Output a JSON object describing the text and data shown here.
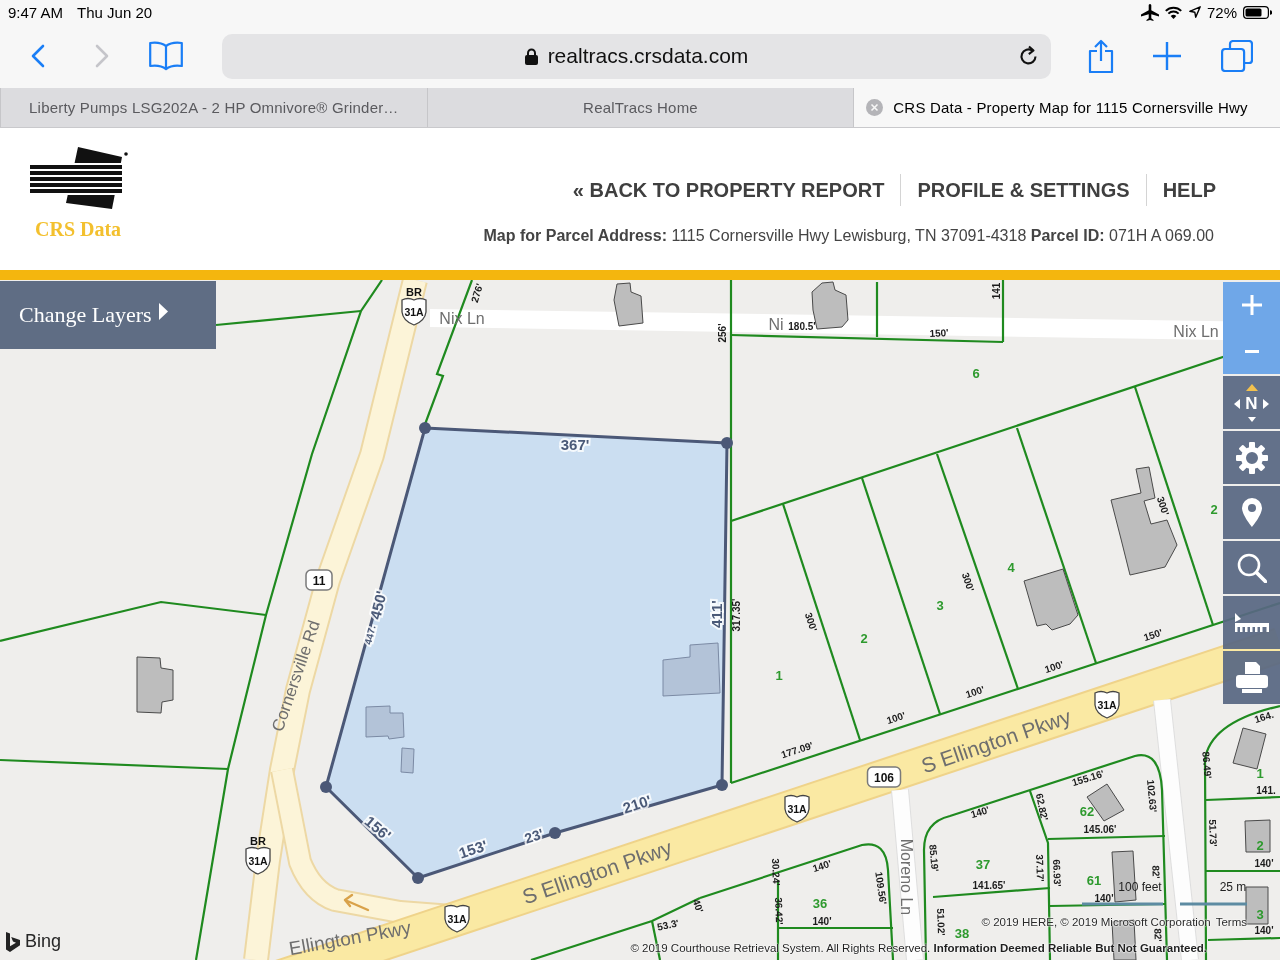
{
  "status_bar": {
    "time": "9:47 AM",
    "date": "Thu Jun 20",
    "battery": "72%"
  },
  "browser": {
    "url": "realtracs.crsdata.com",
    "tabs": [
      {
        "title": "Liberty Pumps LSG202A - 2 HP Omnivore® Grinder…",
        "selected": false
      },
      {
        "title": "RealTracs Home",
        "selected": false
      },
      {
        "title": "CRS Data - Property Map for 1115 Cornersville Hwy",
        "selected": true
      }
    ]
  },
  "header": {
    "logo_text": "CRS Data",
    "nav": [
      "« BACK TO PROPERTY REPORT",
      "PROFILE & SETTINGS",
      "HELP"
    ],
    "parcel_info": "**Map for Parcel Address:** 1115 Cornersville Hwy Lewisburg, TN 37091-4318 **Parcel ID:** 071H A 069.00"
  },
  "map": {
    "layers_button": "Change Layers",
    "compass_label": "N",
    "road_labels": [
      "Nix Ln",
      "Ni",
      "Nix Ln",
      "Cornersville Rd",
      "S Ellington Pkwy",
      "S Ellington Pkwy",
      "Ellington Pkwy",
      "Moreno Ln"
    ],
    "route_shields": [
      {
        "kind": "us_route",
        "prefix": "BR",
        "number": "31A"
      },
      {
        "kind": "state_route",
        "number": "11"
      },
      {
        "kind": "us_route",
        "number": "31A"
      },
      {
        "kind": "state_route",
        "number": "106"
      },
      {
        "kind": "us_route",
        "number": "31A"
      },
      {
        "kind": "us_route",
        "prefix": "BR",
        "number": "31A"
      },
      {
        "kind": "us_route",
        "number": "31A"
      }
    ],
    "parcel_edge_labels": [
      "367'",
      "411'",
      "450'",
      "447.",
      "156'",
      "153'",
      "23'",
      "210'"
    ],
    "dimension_labels": [
      "276'",
      "141",
      "256'",
      "180.5'",
      "150'",
      "300'",
      "300'",
      "317.35'",
      "300'",
      "150'",
      "100'",
      "100'",
      "164.",
      "100'",
      "177.09'",
      "86.49'",
      "155.16'",
      "141.",
      "102.63'",
      "140'",
      "62.82'",
      "145.06'",
      "51.73'",
      "85.19'",
      "140'",
      "140'",
      "37.17'",
      "66.93'",
      "82'",
      "141.65'",
      "109.56'",
      "30.24'",
      "36.42'",
      "140'",
      "40'",
      "53.3'",
      "140'",
      "51.02'",
      "82'",
      "140'"
    ],
    "lot_numbers": [
      "6",
      "2",
      "4",
      "3",
      "2",
      "1",
      "1",
      "62",
      "2",
      "37",
      "61",
      "36",
      "3",
      "38"
    ],
    "scale": [
      "100 feet",
      "25 m"
    ],
    "attribution": {
      "providers": "© 2019 HERE, © 2019 Microsoft Corporation",
      "terms_link": "Terms",
      "notice": "© 2019 Courthouse Retrieval System. All Rights Reserved. **Information Deemed Reliable But Not Guaranteed.**"
    },
    "provider_logo": "Bing"
  }
}
